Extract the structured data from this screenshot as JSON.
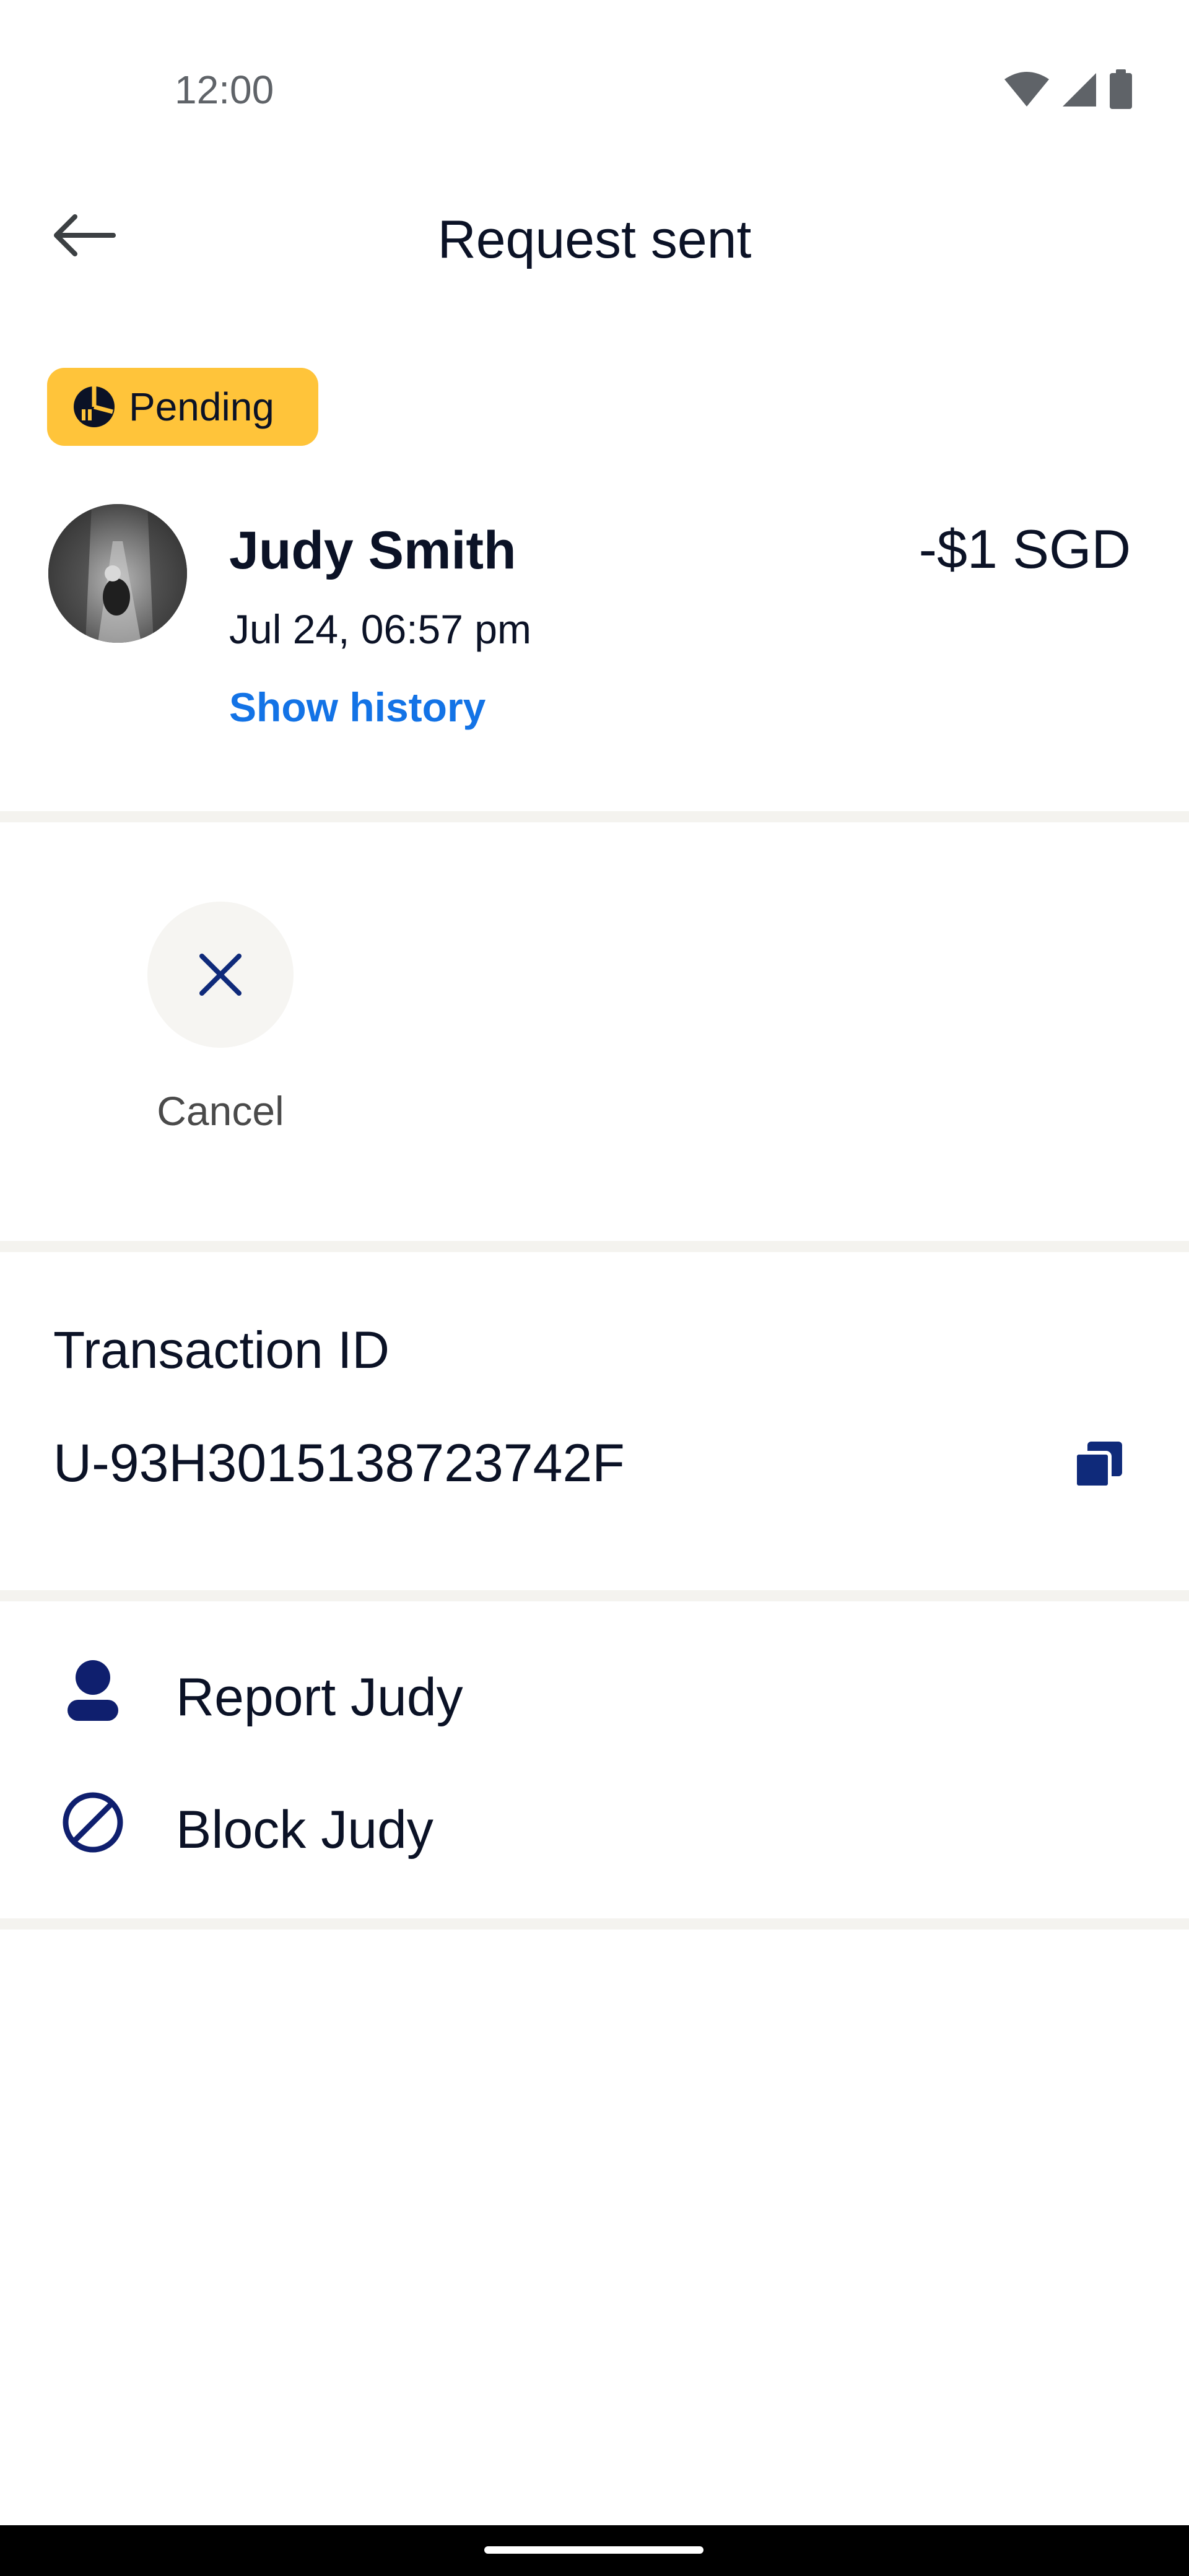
{
  "status_bar": {
    "time": "12:00",
    "icons": [
      "wifi-icon",
      "cellular-signal-icon",
      "battery-icon"
    ]
  },
  "app_bar": {
    "back_icon": "arrow-left-icon",
    "title": "Request sent"
  },
  "status_badge": {
    "label": "Pending",
    "icon": "pending-clock-icon",
    "color": "#ffc43a"
  },
  "transaction": {
    "contact_name": "Judy Smith",
    "amount": "-$1 SGD",
    "date": "Jul 24, 06:57 pm",
    "show_history_label": "Show history"
  },
  "actions": {
    "cancel_label": "Cancel",
    "cancel_icon": "close-icon"
  },
  "transaction_id": {
    "label": "Transaction ID",
    "value": "U-93H3015138723742F",
    "copy_icon": "copy-icon"
  },
  "contact_actions": [
    {
      "label": "Report Judy",
      "icon": "person-icon"
    },
    {
      "label": "Block Judy",
      "icon": "block-icon"
    }
  ],
  "colors": {
    "text_primary": "#0b1226",
    "link": "#1373e6",
    "icon_navy": "#0f2a7a",
    "divider": "#f4f3ef"
  }
}
